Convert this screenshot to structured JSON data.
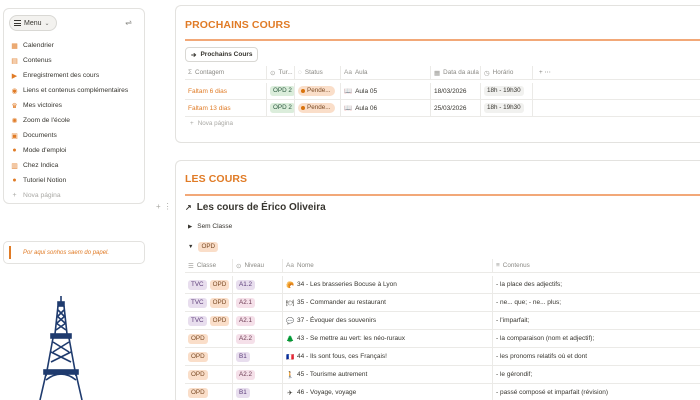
{
  "sidebar": {
    "menu_label": "Menu",
    "items": [
      {
        "label": "Calendrier",
        "icon": "calendar-icon",
        "glyph": "▦"
      },
      {
        "label": "Contenus",
        "icon": "list-icon",
        "glyph": "▤"
      },
      {
        "label": "Enregistrement des cours",
        "icon": "video-icon",
        "glyph": "▶"
      },
      {
        "label": "Liens et contenus complémentaires",
        "icon": "link-icon",
        "glyph": "◉"
      },
      {
        "label": "Mes victoires",
        "icon": "trophy-icon",
        "glyph": "♛"
      },
      {
        "label": "Zoom de l'école",
        "icon": "sun-icon",
        "glyph": "✺"
      },
      {
        "label": "Documents",
        "icon": "document-icon",
        "glyph": "▣"
      },
      {
        "label": "Mode d'emploi",
        "icon": "info-icon",
        "glyph": "●"
      },
      {
        "label": "Chez Indica",
        "icon": "building-icon",
        "glyph": "▥"
      },
      {
        "label": "Tutoriel Notion",
        "icon": "circle-icon",
        "glyph": "●"
      }
    ],
    "new_page": "Nova página",
    "quote": "Por aqui sonhos saem do papel."
  },
  "upcoming": {
    "title": "PROCHAINS COURS",
    "view_tab": "Prochains Cours",
    "columns": [
      {
        "label": "Contagem",
        "icon": "Σ"
      },
      {
        "label": "Tur...",
        "icon": "⊙"
      },
      {
        "label": "Status",
        "icon": "◌"
      },
      {
        "label": "Aula",
        "icon": "Aa"
      },
      {
        "label": "Data da aula",
        "icon": "▦"
      },
      {
        "label": "Horário",
        "icon": "◷"
      }
    ],
    "rows": [
      {
        "count": "Faltam 6 dias",
        "turma": "OPD 2",
        "status": "Pende...",
        "aula": "Aula 05",
        "date": "18/03/2026",
        "time": "18h - 19h30"
      },
      {
        "count": "Faltam 13 dias",
        "turma": "OPD 2",
        "status": "Pende...",
        "aula": "Aula 06",
        "date": "25/03/2026",
        "time": "18h - 19h30"
      }
    ],
    "new_page": "Nova página"
  },
  "courses": {
    "title": "LES COURS",
    "db_title": "Les cours de Érico Oliveira",
    "group_none": "Sem Classe",
    "group_opd": "OPD",
    "columns": [
      {
        "label": "Classe",
        "icon": "☰"
      },
      {
        "label": "Niveau",
        "icon": "⊙"
      },
      {
        "label": "Nome",
        "icon": "Aa"
      },
      {
        "label": "Contenus",
        "icon": "≡"
      }
    ],
    "rows": [
      {
        "classes": [
          "TVC",
          "OPD"
        ],
        "level": "A1.2",
        "level_color": "purple",
        "emoji": "🥐",
        "name": "34 - Les brasseries Bocuse à Lyon",
        "content": "- la place des adjectifs;"
      },
      {
        "classes": [
          "TVC",
          "OPD"
        ],
        "level": "A2.1",
        "level_color": "pink",
        "emoji": "🍽",
        "name": "35 - Commander au restaurant",
        "content": "- ne... que; - ne... plus;"
      },
      {
        "classes": [
          "TVC",
          "OPD"
        ],
        "level": "A2.1",
        "level_color": "pink",
        "emoji": "💬",
        "name": "37 - Évoquer des souvenirs",
        "content": "- l'imparfait;"
      },
      {
        "classes": [
          "OPD"
        ],
        "level": "A2.2",
        "level_color": "pink",
        "emoji": "🌲",
        "name": "43 - Se mettre au vert: les néo-ruraux",
        "content": "- la comparaison (nom et adjectif);"
      },
      {
        "classes": [
          "OPD"
        ],
        "level": "B1",
        "level_color": "purple",
        "emoji": "🇫🇷",
        "name": "44 - Ils sont fous, ces Français!",
        "content": "- les pronoms relatifs où et dont"
      },
      {
        "classes": [
          "OPD"
        ],
        "level": "A2.2",
        "level_color": "pink",
        "emoji": "🚶",
        "name": "45 - Tourisme autrement",
        "content": "- le gérondif;"
      },
      {
        "classes": [
          "OPD"
        ],
        "level": "B1",
        "level_color": "purple",
        "emoji": "✈",
        "name": "46 - Voyage, voyage",
        "content": "- passé composé et imparfait (révision)"
      }
    ]
  },
  "colors": {
    "accent": "#e07b26",
    "accent_rule": "#f2a878",
    "tower": "#1f3b6e"
  }
}
